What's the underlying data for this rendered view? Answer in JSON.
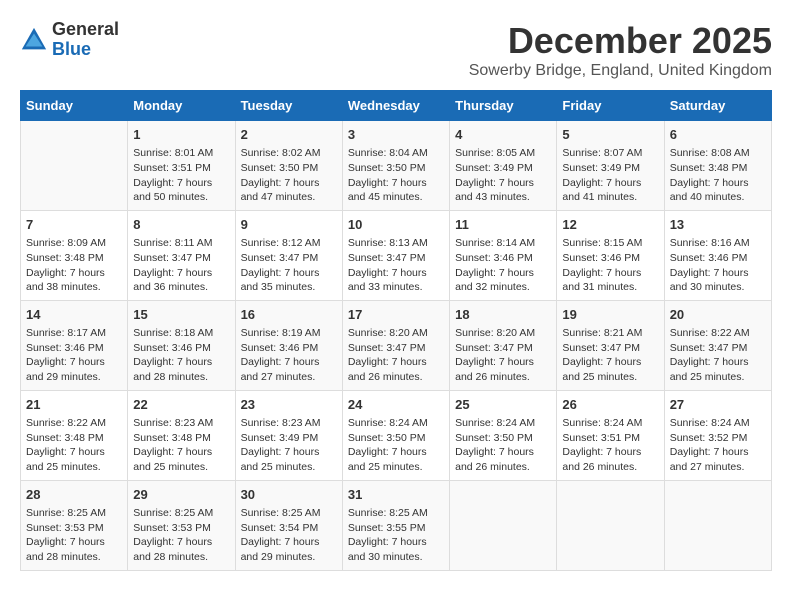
{
  "logo": {
    "general": "General",
    "blue": "Blue"
  },
  "header": {
    "month": "December 2025",
    "location": "Sowerby Bridge, England, United Kingdom"
  },
  "weekdays": [
    "Sunday",
    "Monday",
    "Tuesday",
    "Wednesday",
    "Thursday",
    "Friday",
    "Saturday"
  ],
  "weeks": [
    [
      {
        "day": "",
        "info": ""
      },
      {
        "day": "1",
        "info": "Sunrise: 8:01 AM\nSunset: 3:51 PM\nDaylight: 7 hours\nand 50 minutes."
      },
      {
        "day": "2",
        "info": "Sunrise: 8:02 AM\nSunset: 3:50 PM\nDaylight: 7 hours\nand 47 minutes."
      },
      {
        "day": "3",
        "info": "Sunrise: 8:04 AM\nSunset: 3:50 PM\nDaylight: 7 hours\nand 45 minutes."
      },
      {
        "day": "4",
        "info": "Sunrise: 8:05 AM\nSunset: 3:49 PM\nDaylight: 7 hours\nand 43 minutes."
      },
      {
        "day": "5",
        "info": "Sunrise: 8:07 AM\nSunset: 3:49 PM\nDaylight: 7 hours\nand 41 minutes."
      },
      {
        "day": "6",
        "info": "Sunrise: 8:08 AM\nSunset: 3:48 PM\nDaylight: 7 hours\nand 40 minutes."
      }
    ],
    [
      {
        "day": "7",
        "info": "Sunrise: 8:09 AM\nSunset: 3:48 PM\nDaylight: 7 hours\nand 38 minutes."
      },
      {
        "day": "8",
        "info": "Sunrise: 8:11 AM\nSunset: 3:47 PM\nDaylight: 7 hours\nand 36 minutes."
      },
      {
        "day": "9",
        "info": "Sunrise: 8:12 AM\nSunset: 3:47 PM\nDaylight: 7 hours\nand 35 minutes."
      },
      {
        "day": "10",
        "info": "Sunrise: 8:13 AM\nSunset: 3:47 PM\nDaylight: 7 hours\nand 33 minutes."
      },
      {
        "day": "11",
        "info": "Sunrise: 8:14 AM\nSunset: 3:46 PM\nDaylight: 7 hours\nand 32 minutes."
      },
      {
        "day": "12",
        "info": "Sunrise: 8:15 AM\nSunset: 3:46 PM\nDaylight: 7 hours\nand 31 minutes."
      },
      {
        "day": "13",
        "info": "Sunrise: 8:16 AM\nSunset: 3:46 PM\nDaylight: 7 hours\nand 30 minutes."
      }
    ],
    [
      {
        "day": "14",
        "info": "Sunrise: 8:17 AM\nSunset: 3:46 PM\nDaylight: 7 hours\nand 29 minutes."
      },
      {
        "day": "15",
        "info": "Sunrise: 8:18 AM\nSunset: 3:46 PM\nDaylight: 7 hours\nand 28 minutes."
      },
      {
        "day": "16",
        "info": "Sunrise: 8:19 AM\nSunset: 3:46 PM\nDaylight: 7 hours\nand 27 minutes."
      },
      {
        "day": "17",
        "info": "Sunrise: 8:20 AM\nSunset: 3:47 PM\nDaylight: 7 hours\nand 26 minutes."
      },
      {
        "day": "18",
        "info": "Sunrise: 8:20 AM\nSunset: 3:47 PM\nDaylight: 7 hours\nand 26 minutes."
      },
      {
        "day": "19",
        "info": "Sunrise: 8:21 AM\nSunset: 3:47 PM\nDaylight: 7 hours\nand 25 minutes."
      },
      {
        "day": "20",
        "info": "Sunrise: 8:22 AM\nSunset: 3:47 PM\nDaylight: 7 hours\nand 25 minutes."
      }
    ],
    [
      {
        "day": "21",
        "info": "Sunrise: 8:22 AM\nSunset: 3:48 PM\nDaylight: 7 hours\nand 25 minutes."
      },
      {
        "day": "22",
        "info": "Sunrise: 8:23 AM\nSunset: 3:48 PM\nDaylight: 7 hours\nand 25 minutes."
      },
      {
        "day": "23",
        "info": "Sunrise: 8:23 AM\nSunset: 3:49 PM\nDaylight: 7 hours\nand 25 minutes."
      },
      {
        "day": "24",
        "info": "Sunrise: 8:24 AM\nSunset: 3:50 PM\nDaylight: 7 hours\nand 25 minutes."
      },
      {
        "day": "25",
        "info": "Sunrise: 8:24 AM\nSunset: 3:50 PM\nDaylight: 7 hours\nand 26 minutes."
      },
      {
        "day": "26",
        "info": "Sunrise: 8:24 AM\nSunset: 3:51 PM\nDaylight: 7 hours\nand 26 minutes."
      },
      {
        "day": "27",
        "info": "Sunrise: 8:24 AM\nSunset: 3:52 PM\nDaylight: 7 hours\nand 27 minutes."
      }
    ],
    [
      {
        "day": "28",
        "info": "Sunrise: 8:25 AM\nSunset: 3:53 PM\nDaylight: 7 hours\nand 28 minutes."
      },
      {
        "day": "29",
        "info": "Sunrise: 8:25 AM\nSunset: 3:53 PM\nDaylight: 7 hours\nand 28 minutes."
      },
      {
        "day": "30",
        "info": "Sunrise: 8:25 AM\nSunset: 3:54 PM\nDaylight: 7 hours\nand 29 minutes."
      },
      {
        "day": "31",
        "info": "Sunrise: 8:25 AM\nSunset: 3:55 PM\nDaylight: 7 hours\nand 30 minutes."
      },
      {
        "day": "",
        "info": ""
      },
      {
        "day": "",
        "info": ""
      },
      {
        "day": "",
        "info": ""
      }
    ]
  ]
}
